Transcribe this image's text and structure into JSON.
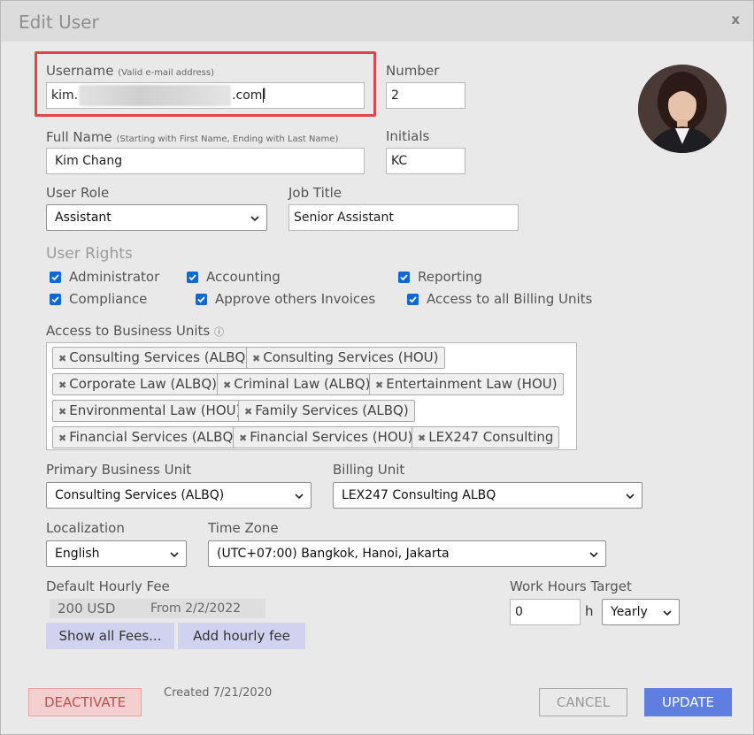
{
  "dialog": {
    "title": "Edit User",
    "close": "x"
  },
  "username": {
    "label": "Username",
    "hint": "(Valid e-mail address)",
    "prefix": "kim.",
    "suffix": ".com"
  },
  "number": {
    "label": "Number",
    "value": "2"
  },
  "fullname": {
    "label": "Full Name",
    "hint": "(Starting with First Name, Ending with Last Name)",
    "value": "Kim Chang"
  },
  "initials": {
    "label": "Initials",
    "value": "KC"
  },
  "role": {
    "label": "User Role",
    "value": "Assistant"
  },
  "job": {
    "label": "Job Title",
    "value": "Senior Assistant"
  },
  "rights": {
    "label": "User Rights",
    "items": [
      "Administrator",
      "Accounting",
      "Reporting",
      "Compliance",
      "Approve others Invoices",
      "Access to all Billing Units"
    ]
  },
  "business_units": {
    "label": "Access to Business Units",
    "info_icon": "ⓘ",
    "tags": [
      "Consulting Services (ALBQ)",
      "Consulting Services (HOU)",
      "Corporate Law (ALBQ)",
      "Criminal Law (ALBQ)",
      "Entertainment Law (HOU)",
      "Environmental Law (HOU)",
      "Family Services (ALBQ)",
      "Financial Services (ALBQ)",
      "Financial Services (HOU)",
      "LEX247 Consulting"
    ]
  },
  "primary_unit": {
    "label": "Primary Business Unit",
    "value": "Consulting Services (ALBQ)"
  },
  "billing_unit": {
    "label": "Billing Unit",
    "value": "LEX247 Consulting ALBQ"
  },
  "localization": {
    "label": "Localization",
    "value": "English"
  },
  "timezone": {
    "label": "Time Zone",
    "value": "(UTC+07:00) Bangkok, Hanoi, Jakarta"
  },
  "fee": {
    "label": "Default Hourly Fee",
    "amount": "200 USD",
    "from": "From 2/2/2022",
    "show_all": "Show all Fees...",
    "add": "Add hourly fee"
  },
  "work_hours": {
    "label": "Work Hours Target",
    "value": "0",
    "unit": "h",
    "period": "Yearly"
  },
  "footer": {
    "deactivate": "DEACTIVATE",
    "created": "Created 7/21/2020",
    "cancel": "CANCEL",
    "update": "UPDATE"
  },
  "colors": {
    "primary": "#5e7fe0",
    "danger_bg": "#f4cfcf",
    "checkbox": "#0a68d8",
    "highlight": "#e0454a"
  }
}
